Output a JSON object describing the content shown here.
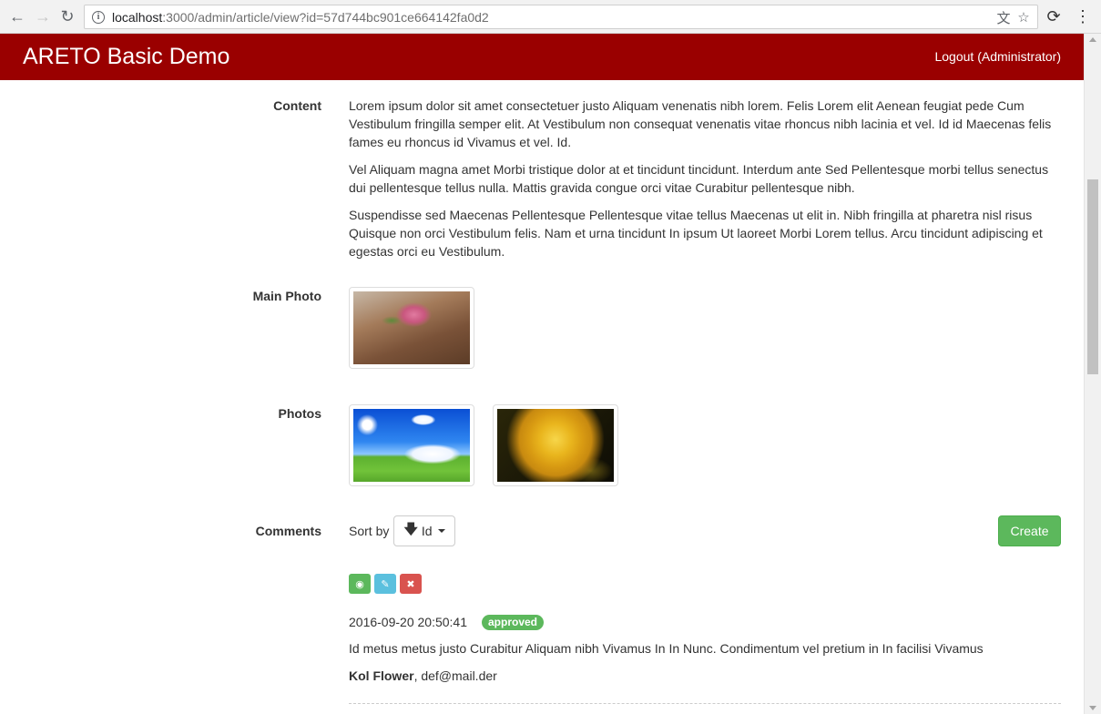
{
  "browser": {
    "url_host": "localhost",
    "url_rest": ":3000/admin/article/view?id=57d744bc901ce664142fa0d2"
  },
  "navbar": {
    "brand": "ARETO Basic Demo",
    "logout": "Logout (Administrator)",
    "color": "#9a0000"
  },
  "content": {
    "label": "Content",
    "paragraphs": [
      "Lorem ipsum dolor sit amet consectetuer justo Aliquam venenatis nibh lorem. Felis Lorem elit Aenean feugiat pede Cum Vestibulum fringilla semper elit. At Vestibulum non consequat venenatis vitae rhoncus nibh lacinia et vel. Id id Maecenas felis fames eu rhoncus id Vivamus et vel. Id.",
      "Vel Aliquam magna amet Morbi tristique dolor at et tincidunt tincidunt. Interdum ante Sed Pellentesque morbi tellus senectus dui pellentesque tellus nulla. Mattis gravida congue orci vitae Curabitur pellentesque nibh.",
      "Suspendisse sed Maecenas Pellentesque Pellentesque vitae tellus Maecenas ut elit in. Nibh fringilla at pharetra nisl risus Quisque non orci Vestibulum felis. Nam et urna tincidunt In ipsum Ut laoreet Morbi Lorem tellus. Arcu tincidunt adipiscing et egestas orci eu Vestibulum."
    ]
  },
  "main_photo": {
    "label": "Main Photo"
  },
  "photos": {
    "label": "Photos"
  },
  "comments": {
    "label": "Comments",
    "sort_by_label": "Sort by",
    "sort_value": "Id",
    "create_label": "Create",
    "items": [
      {
        "date": "2016-09-20 20:50:41",
        "status": "approved",
        "text": "Id metus metus justo Curabitur Aliquam nibh Vivamus In In Nunc. Condimentum vel pretium in In facilisi Vivamus",
        "author": "Kol Flower",
        "email": ", def@mail.der"
      }
    ]
  },
  "colors": {
    "success": "#5cb85c",
    "info": "#5bc0de",
    "danger": "#d9534f"
  }
}
